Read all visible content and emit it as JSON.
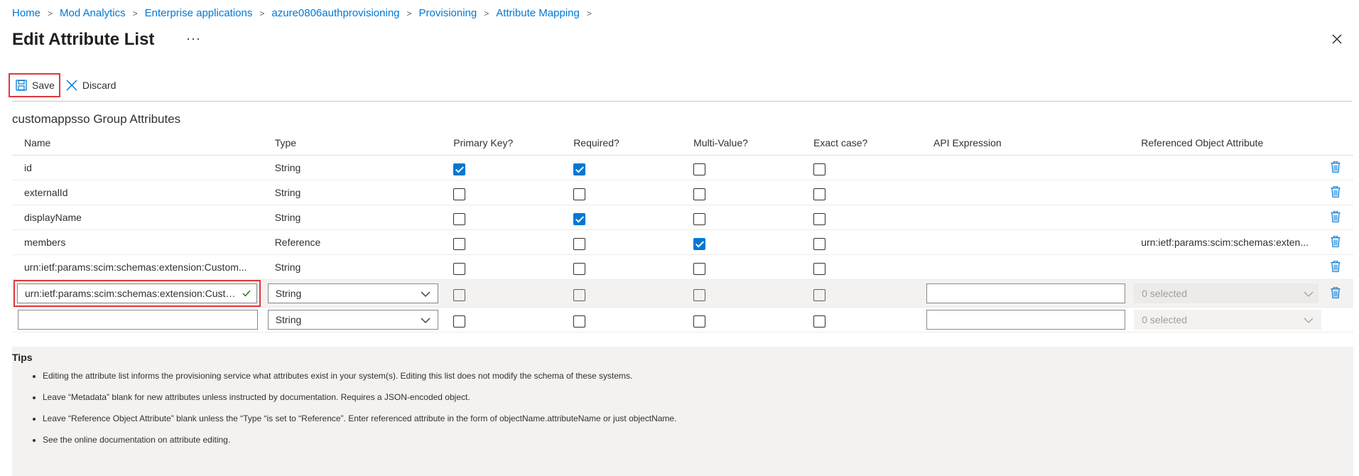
{
  "breadcrumb": [
    "Home",
    "Mod Analytics",
    "Enterprise applications",
    "azure0806authprovisioning",
    "Provisioning",
    "Attribute Mapping"
  ],
  "page_title": "Edit Attribute List",
  "more_label": "···",
  "toolbar": {
    "save_label": "Save",
    "discard_label": "Discard"
  },
  "section_title": "customappsso Group Attributes",
  "columns": [
    "Name",
    "Type",
    "Primary Key?",
    "Required?",
    "Multi-Value?",
    "Exact case?",
    "API Expression",
    "Referenced Object Attribute"
  ],
  "rows": [
    {
      "name": "id",
      "type": "String",
      "primary_key": true,
      "required": true,
      "multi_value": false,
      "exact_case": false,
      "ref": ""
    },
    {
      "name": "externalId",
      "type": "String",
      "primary_key": false,
      "required": false,
      "multi_value": false,
      "exact_case": false,
      "ref": ""
    },
    {
      "name": "displayName",
      "type": "String",
      "primary_key": false,
      "required": true,
      "multi_value": false,
      "exact_case": false,
      "ref": ""
    },
    {
      "name": "members",
      "type": "Reference",
      "primary_key": false,
      "required": false,
      "multi_value": true,
      "exact_case": false,
      "ref": "urn:ietf:params:scim:schemas:exten..."
    },
    {
      "name": "urn:ietf:params:scim:schemas:extension:Custom...",
      "type": "String",
      "primary_key": false,
      "required": false,
      "multi_value": false,
      "exact_case": false,
      "ref": ""
    }
  ],
  "editing_row": {
    "name_value": "urn:ietf:params:scim:schemas:extension:Custo...",
    "type": "String",
    "api_expression": "",
    "ref_placeholder": "0 selected"
  },
  "new_row": {
    "name_value": "",
    "type": "String",
    "api_expression": "",
    "ref_placeholder": "0 selected"
  },
  "tips": {
    "heading": "Tips",
    "items": [
      "Editing the attribute list informs the provisioning service what attributes exist in your system(s). Editing this list does not modify the schema of these systems.",
      "Leave “Metadata” blank for new attributes unless instructed by documentation. Requires a JSON-encoded object.",
      "Leave “Reference Object Attribute” blank unless the “Type “is set to “Reference”. Enter referenced attribute in the form of objectName.attributeName or just objectName.",
      "See the online documentation on attribute editing."
    ]
  },
  "colors": {
    "accent": "#0078d4",
    "highlight": "#e0383e",
    "success": "#107c10"
  }
}
